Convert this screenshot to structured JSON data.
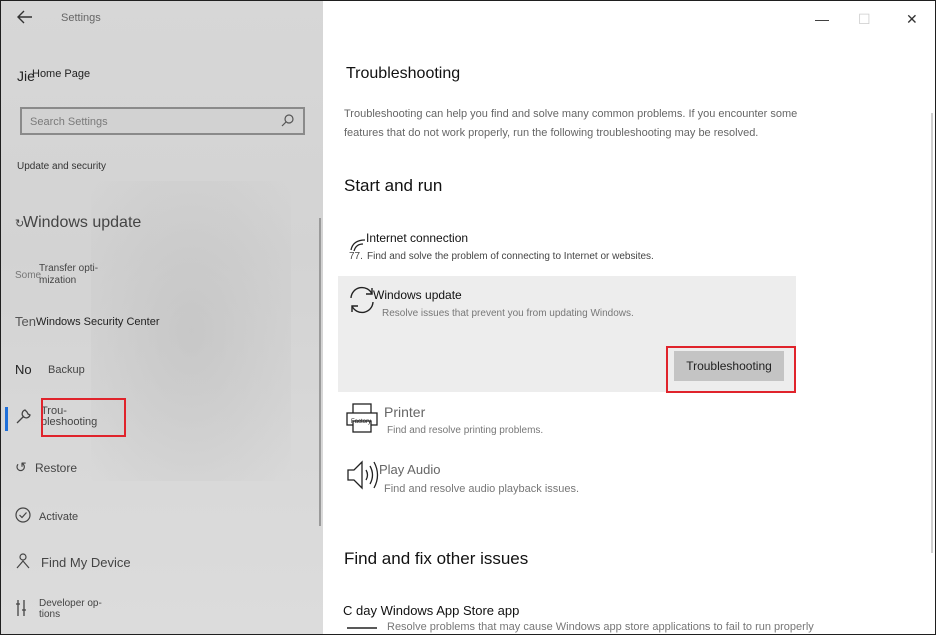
{
  "window": {
    "app_title": "Settings",
    "back_icon": "arrow-left",
    "controls": {
      "minimize": "—",
      "maximize": "☐",
      "close": "✕"
    }
  },
  "sidebar": {
    "home_prefix": "Jie",
    "home_label": "Home Page",
    "search_placeholder": "Search Settings",
    "section_label": "Update and security",
    "items": [
      {
        "prefix": "↻",
        "label": "Windows update"
      },
      {
        "prefix": "Some",
        "label": "Transfer opti-\nmization"
      },
      {
        "prefix": "Ten",
        "label": "Windows Security Center"
      },
      {
        "prefix": "No",
        "label": "Backup"
      },
      {
        "prefix": "🔧",
        "label": "Trou-\nbleshooting"
      },
      {
        "prefix": "↺",
        "label": "Restore"
      },
      {
        "prefix": "✓",
        "label": "Activate"
      },
      {
        "prefix": "⚲",
        "label": "Find My Device"
      },
      {
        "prefix": "⚙",
        "label": "Developer op-\ntions"
      }
    ]
  },
  "main": {
    "title": "Troubleshooting",
    "description": "Troubleshooting can help you find and solve many common problems. If you encounter some features that do not work properly, run the following troubleshooting may be resolved.",
    "start_section": "Start and run",
    "items": [
      {
        "title": "Internet connection",
        "prefix": "77.",
        "desc": "Find and solve the problem of connecting to Internet or websites."
      },
      {
        "title": "Windows update",
        "desc": "Resolve issues that prevent you from updating Windows."
      },
      {
        "title": "Printer",
        "desc": "Find and resolve printing problems.",
        "icon_label": "Factory"
      },
      {
        "title": "Play Audio",
        "desc": "Find and resolve audio playback issues."
      }
    ],
    "run_button": "Troubleshooting",
    "other_section": "Find and fix other issues",
    "other_items": [
      {
        "title": "C day Windows App Store app",
        "desc": "Resolve problems that may cause Windows app store applications to fail to run properly"
      }
    ]
  },
  "colors": {
    "accent": "#1e6fd9",
    "highlight": "#e0232b",
    "sidebar_bg": "#d6d6d6",
    "expanded_bg": "#ededed",
    "button_bg": "#c4c4c4"
  }
}
